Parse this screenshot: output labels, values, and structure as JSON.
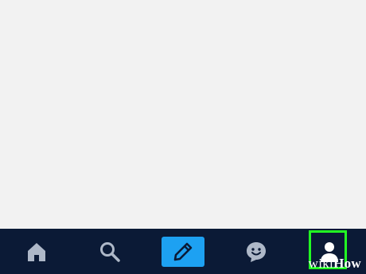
{
  "tab_bar": {
    "items": [
      {
        "id": "home",
        "icon": "home-icon"
      },
      {
        "id": "search",
        "icon": "search-icon"
      },
      {
        "id": "compose",
        "icon": "pencil-icon",
        "accent": "#1da1f2"
      },
      {
        "id": "chat",
        "icon": "smiley-icon"
      },
      {
        "id": "profile",
        "icon": "person-icon",
        "highlighted": true
      }
    ],
    "background": "#0b1a36",
    "icon_color": "#aeb8c8",
    "highlight_color": "#22ff22"
  },
  "watermark": {
    "part1": "wiki",
    "part2": "How"
  }
}
